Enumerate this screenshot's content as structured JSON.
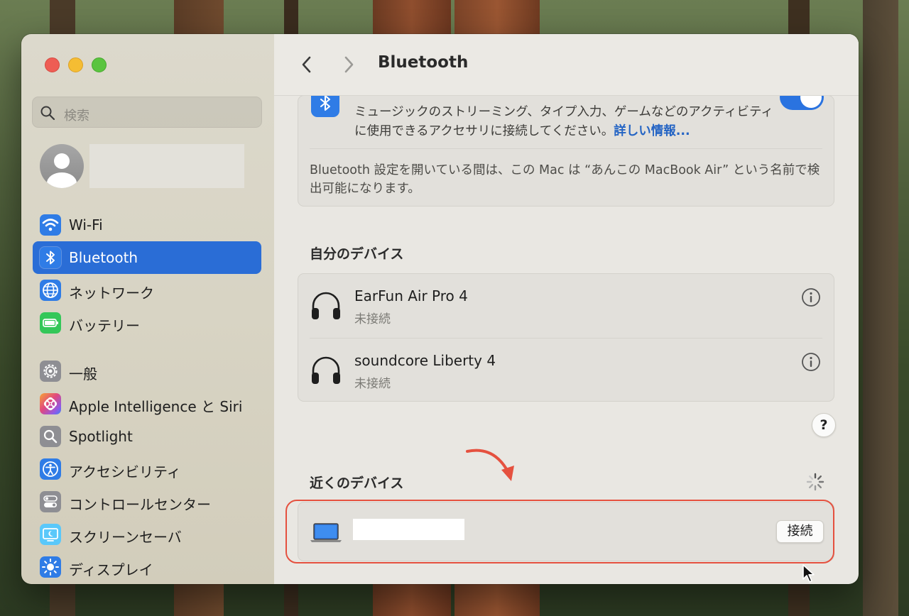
{
  "window": {
    "title": "Bluetooth"
  },
  "sidebar": {
    "search": {
      "placeholder": "検索"
    },
    "items": [
      {
        "label": "Wi-Fi",
        "icon": "wifi-icon",
        "color": "#2f7ce6"
      },
      {
        "label": "Bluetooth",
        "icon": "bluetooth-icon",
        "color": "#2f7ce6",
        "selected": true
      },
      {
        "label": "ネットワーク",
        "icon": "globe-icon",
        "color": "#2f7ce6"
      },
      {
        "label": "バッテリー",
        "icon": "battery-icon",
        "color": "#34c759"
      },
      {
        "label": "一般",
        "icon": "gear-icon",
        "color": "#8e8e93"
      },
      {
        "label": "Apple Intelligence と Siri",
        "icon": "siri-icon",
        "color": "#c45bd8"
      },
      {
        "label": "Spotlight",
        "icon": "spotlight-icon",
        "color": "#8e8e93"
      },
      {
        "label": "アクセシビリティ",
        "icon": "accessibility-icon",
        "color": "#2f7ce6"
      },
      {
        "label": "コントロールセンター",
        "icon": "control-center-icon",
        "color": "#8e8e93"
      },
      {
        "label": "スクリーンセーバ",
        "icon": "screensaver-icon",
        "color": "#5ac8fa"
      },
      {
        "label": "ディスプレイ",
        "icon": "display-icon",
        "color": "#2f7ce6"
      }
    ]
  },
  "bluetooth": {
    "description": "ミュージックのストリーミング、タイプ入力、ゲームなどのアクティビティに使用できるアクセサリに接続してください。",
    "link": "詳しい情報...",
    "enabled": true,
    "discoverable_note": "Bluetooth 設定を開いている間は、この Mac は “あんこの MacBook Air” という名前で検出可能になります。"
  },
  "my_devices": {
    "heading": "自分のデバイス",
    "devices": [
      {
        "name": "EarFun Air Pro 4",
        "status": "未接続",
        "icon": "headphones-icon"
      },
      {
        "name": "soundcore Liberty 4",
        "status": "未接続",
        "icon": "headphones-icon"
      }
    ]
  },
  "help": {
    "label": "?"
  },
  "nearby_devices": {
    "heading": "近くのデバイス",
    "devices": [
      {
        "icon": "laptop-icon",
        "connect_label": "接続"
      }
    ]
  },
  "colors": {
    "accent": "#2a6dd6",
    "annotation": "#e5513f"
  }
}
